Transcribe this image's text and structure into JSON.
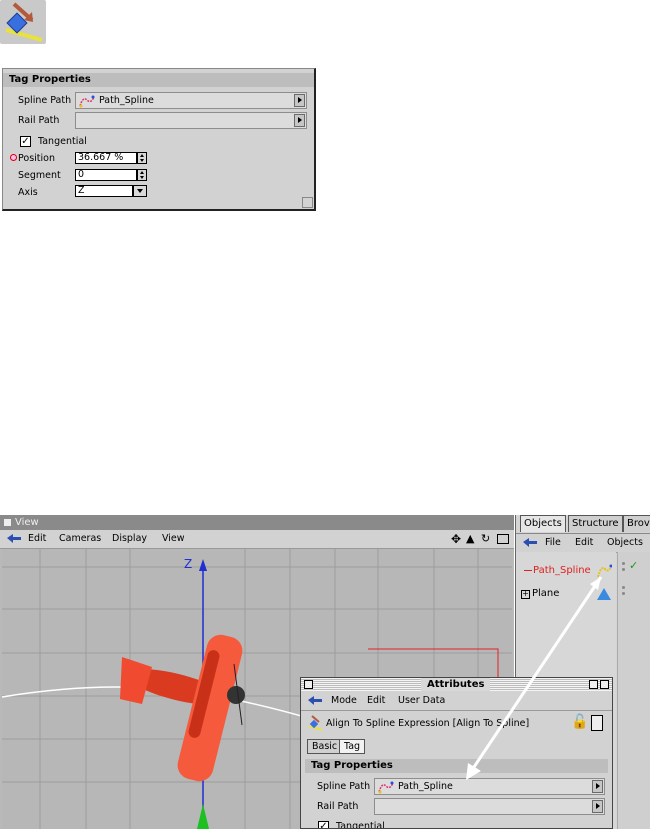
{
  "tag_panel": {
    "section_title": "Tag Properties",
    "spline_path_label": "Spline Path",
    "spline_path_value": "Path_Spline",
    "rail_path_label": "Rail Path",
    "rail_path_value": "",
    "tangential_label": "Tangential",
    "tangential_checked": true,
    "position_label": "Position",
    "position_value": "36.667 %",
    "segment_label": "Segment",
    "segment_value": "0",
    "axis_label": "Axis",
    "axis_value": "Z"
  },
  "viewport": {
    "title": "View",
    "menu": [
      "Edit",
      "Cameras",
      "Display",
      "View"
    ],
    "axis_label": "Z"
  },
  "object_manager": {
    "tabs": [
      "Objects",
      "Structure",
      "Brov"
    ],
    "menu": [
      "File",
      "Edit",
      "Objects"
    ],
    "items": [
      {
        "name": "Path_Spline",
        "color": "#e02020"
      },
      {
        "name": "Plane",
        "color": "#000000"
      }
    ]
  },
  "attributes": {
    "title": "Attributes",
    "menu": [
      "Mode",
      "Edit",
      "User Data"
    ],
    "header_text": "Align To Spline Expression [Align To Spline]",
    "tabs": [
      "Basic",
      "Tag"
    ],
    "section_title": "Tag Properties",
    "spline_path_label": "Spline Path",
    "spline_path_value": "Path_Spline",
    "rail_path_label": "Rail Path",
    "tangential_label": "Tangential"
  },
  "colors": {
    "selected_object": "#e02020",
    "airplane": "#f04a30",
    "axis_blue": "#1f2fd0",
    "panel_bg": "#d2d2d2"
  }
}
